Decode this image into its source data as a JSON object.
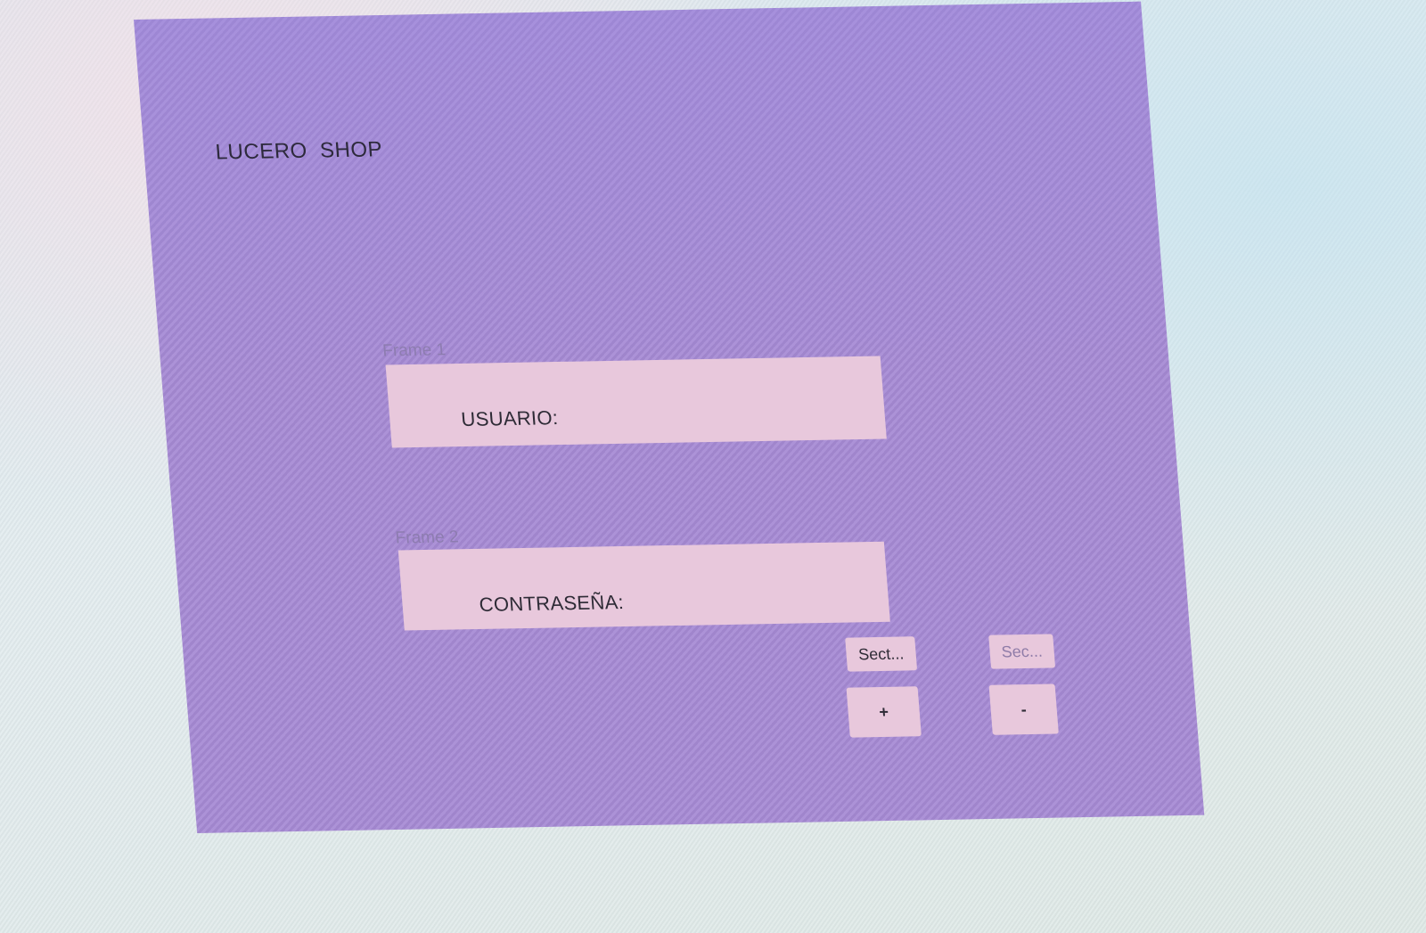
{
  "app": {
    "title": "LUCERO  SHOP"
  },
  "frames": [
    {
      "label": "Frame 1",
      "field_label": "USUARIO:"
    },
    {
      "label": "Frame 2",
      "field_label": "CONTRASEÑA:"
    }
  ],
  "buttons": {
    "sect_label": "Sect...",
    "sec_label": "Sec...",
    "plus_label": "+",
    "minus_label": "-"
  },
  "colors": {
    "canvas": "#a68ad4",
    "frame_fill": "#e8c8dc",
    "frame_label": "#8d7cb0",
    "text": "#2e2b36"
  }
}
